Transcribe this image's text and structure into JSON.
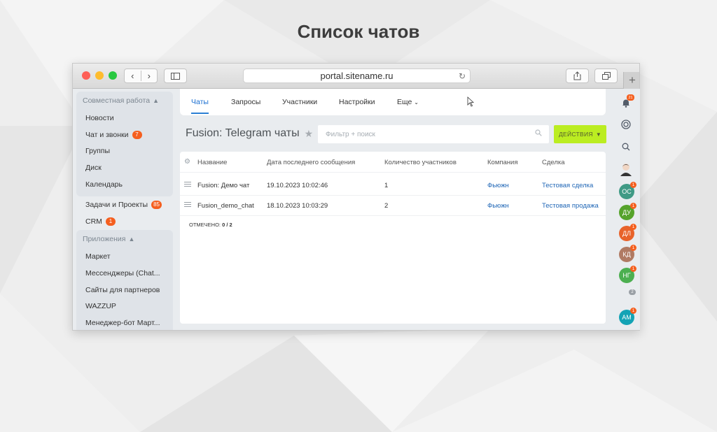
{
  "slide": {
    "title": "Список чатов"
  },
  "browser": {
    "url": "portal.sitename.ru"
  },
  "left_nav": {
    "groups": [
      {
        "title": "Совместная работа",
        "items": [
          {
            "label": "Новости"
          },
          {
            "label": "Чат и звонки",
            "badge": "7"
          },
          {
            "label": "Группы"
          },
          {
            "label": "Диск"
          },
          {
            "label": "Календарь"
          }
        ]
      },
      {
        "title": "Приложения",
        "items": [
          {
            "label": "Маркет"
          },
          {
            "label": "Мессенджеры (Chat..."
          },
          {
            "label": "Сайты для партнеров"
          },
          {
            "label": "WAZZUP"
          },
          {
            "label": "Менеджер-бот Март..."
          }
        ]
      }
    ],
    "loose_items": [
      {
        "label": "Задачи и Проекты",
        "badge": "85"
      },
      {
        "label": "CRM",
        "badge": "1"
      }
    ]
  },
  "tabs": [
    {
      "label": "Чаты",
      "active": true
    },
    {
      "label": "Запросы"
    },
    {
      "label": "Участники"
    },
    {
      "label": "Настройки"
    },
    {
      "label": "Еще"
    }
  ],
  "page": {
    "title": "Fusion: Telegram чаты",
    "filter_placeholder": "Фильтр + поиск",
    "actions_label": "ДЕЙСТВИЯ"
  },
  "grid": {
    "columns": [
      "Название",
      "Дата последнего сообщения",
      "Количество участников",
      "Компания",
      "Сделка"
    ],
    "rows": [
      [
        "Fusion: Демо чат",
        "19.10.2023 10:02:46",
        "1",
        "Фьюжн",
        "Тестовая сделка"
      ],
      [
        "Fusion_demo_chat",
        "18.10.2023 10:03:29",
        "2",
        "Фьюжн",
        "Тестовая продажа"
      ]
    ],
    "selected_label": "ОТМЕЧЕНО:",
    "selected_value": "0 / 2"
  },
  "right_panel": {
    "notification_count": "21",
    "avatars": [
      {
        "initials": "ОС",
        "badge": "1",
        "color": "#3f9a85"
      },
      {
        "initials": "ДУ",
        "badge": "1",
        "color": "#56a32c"
      },
      {
        "initials": "ДЛ",
        "badge": "1",
        "color": "#e8632b"
      },
      {
        "initials": "КД",
        "badge": "1",
        "color": "#b07a63"
      },
      {
        "initials": "НГ",
        "badge": "1",
        "color": "#4caf50"
      },
      {
        "initials": "АМ",
        "badge": "1",
        "color": "#13a3b5"
      }
    ],
    "more_count": "2"
  },
  "colors": {
    "accent": "#2b7fd4",
    "actions_button": "#bbed21",
    "badge": "#f55f1f"
  }
}
